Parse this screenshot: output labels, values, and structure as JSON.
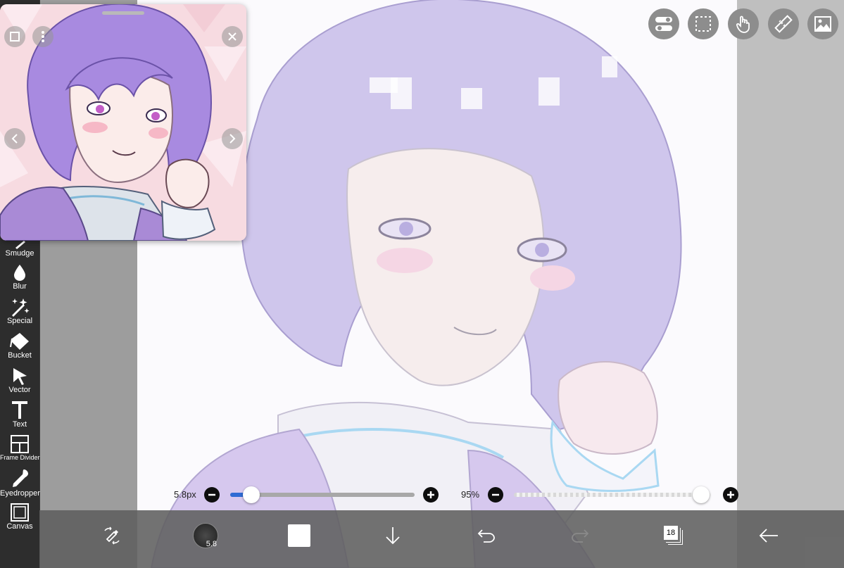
{
  "app": {
    "tools": [
      {
        "id": "smudge",
        "label": "Smudge",
        "icon": "smudge-icon"
      },
      {
        "id": "blur",
        "label": "Blur",
        "icon": "blur-drop-icon"
      },
      {
        "id": "special",
        "label": "Special",
        "icon": "magic-wand-icon"
      },
      {
        "id": "bucket",
        "label": "Bucket",
        "icon": "bucket-icon"
      },
      {
        "id": "vector",
        "label": "Vector",
        "icon": "vector-arrow-icon"
      },
      {
        "id": "text",
        "label": "Text",
        "icon": "text-t-icon"
      },
      {
        "id": "frame-divider",
        "label": "Frame Divider",
        "icon": "frame-divider-icon"
      },
      {
        "id": "eyedropper",
        "label": "Eyedropper",
        "icon": "eyedropper-icon"
      },
      {
        "id": "canvas",
        "label": "Canvas",
        "icon": "canvas-icon"
      }
    ],
    "top_icons": [
      "toggle-icon",
      "selection-icon",
      "gesture-hand-icon",
      "ruler-icon",
      "image-icon"
    ]
  },
  "brush_size": {
    "label": "5.8px",
    "value_fraction": 0.07
  },
  "opacity": {
    "label": "95%",
    "value_fraction": 0.95
  },
  "bottom": {
    "brush_size_badge": "5.8",
    "layer_count": "18"
  },
  "colors": {
    "sidebar": "#2d2d2d",
    "bottom_bar": "#5f5f5f",
    "hair": "#a98de0",
    "slider_fill": "#2f6bd4"
  }
}
